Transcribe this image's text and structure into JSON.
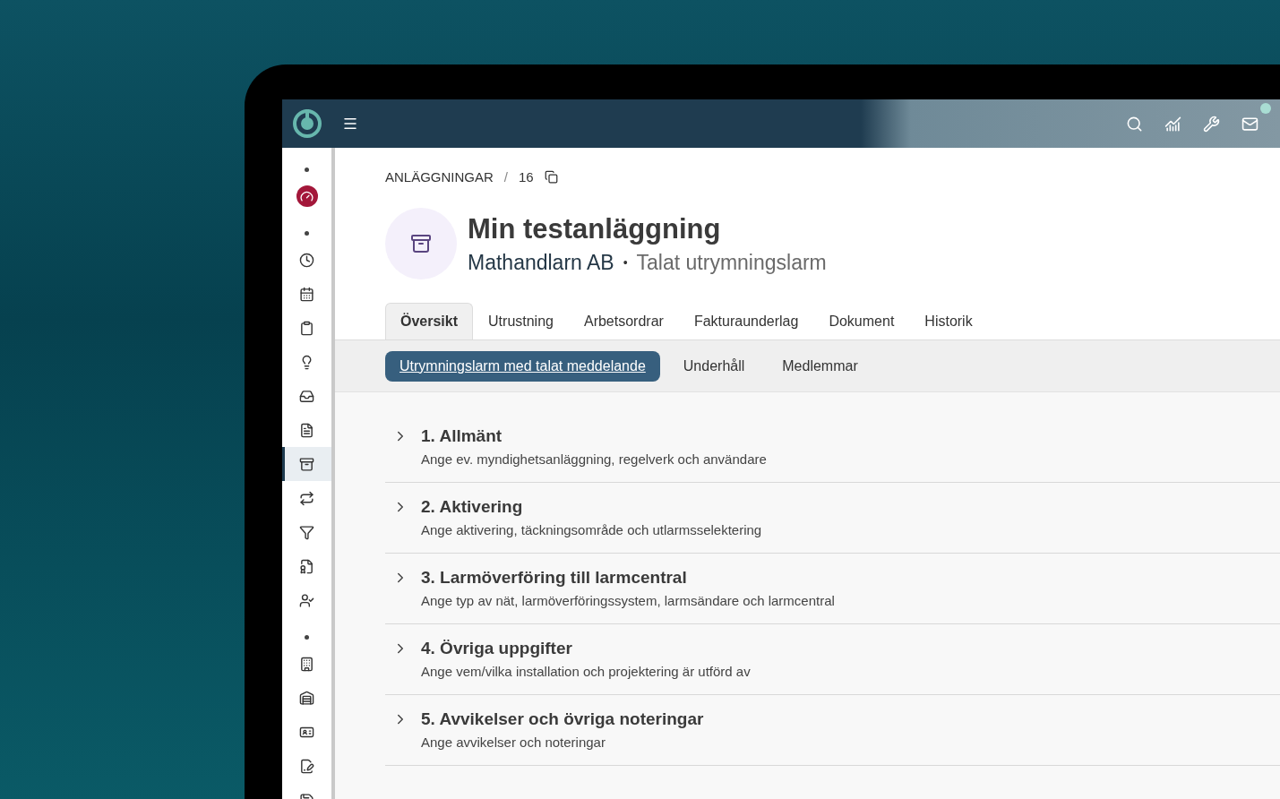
{
  "topbar": {
    "notification": true
  },
  "sidebar": {
    "groups": [
      {
        "items": [
          {
            "selected": false
          }
        ]
      },
      {
        "items": [
          {
            "selected": false
          },
          {
            "selected": false
          },
          {
            "selected": false
          },
          {
            "selected": false
          },
          {
            "selected": false
          },
          {
            "selected": false
          },
          {
            "selected": true
          },
          {
            "selected": false
          },
          {
            "selected": false
          },
          {
            "selected": false
          },
          {
            "selected": false
          }
        ]
      },
      {
        "items": [
          {
            "selected": false
          },
          {
            "selected": false
          },
          {
            "selected": false
          },
          {
            "selected": false
          },
          {
            "selected": false
          }
        ]
      }
    ]
  },
  "breadcrumb": {
    "section": "ANLÄGGNINGAR",
    "separator": "/",
    "id": "16"
  },
  "header": {
    "title": "Min testanläggning",
    "company": "Mathandlarn AB",
    "separator": "•",
    "type": "Talat utrymningslarm"
  },
  "tabs": [
    {
      "label": "Översikt",
      "selected": true
    },
    {
      "label": "Utrustning",
      "selected": false
    },
    {
      "label": "Arbetsordrar",
      "selected": false
    },
    {
      "label": "Fakturaunderlag",
      "selected": false
    },
    {
      "label": "Dokument",
      "selected": false
    },
    {
      "label": "Historik",
      "selected": false
    }
  ],
  "subtabs": [
    {
      "label": "Utrymningslarm med talat meddelande",
      "selected": true
    },
    {
      "label": "Underhåll",
      "selected": false
    },
    {
      "label": "Medlemmar",
      "selected": false
    }
  ],
  "sections": [
    {
      "title": "1. Allmänt",
      "description": "Ange ev. myndighetsanläggning, regelverk och användare",
      "expanded": false
    },
    {
      "title": "2. Aktivering",
      "description": "Ange aktivering, täckningsområde och utlarmsselektering",
      "expanded": false
    },
    {
      "title": "3. Larmöverföring till larmcentral",
      "description": "Ange typ av nät, larmöverföringssystem, larmsändare och larmcentral",
      "expanded": false
    },
    {
      "title": "4. Övriga uppgifter",
      "description": "Ange vem/vilka installation och projektering är utförd av",
      "expanded": false
    },
    {
      "title": "5. Avvikelser och övriga noteringar",
      "description": "Ange avvikelser och noteringar",
      "expanded": false
    }
  ]
}
